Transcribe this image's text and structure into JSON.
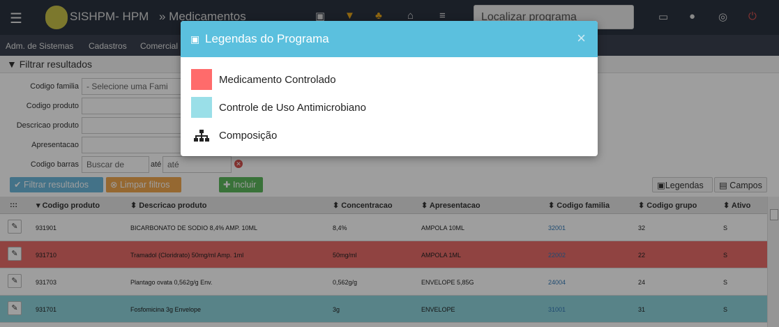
{
  "topbar": {
    "menu_icon": "hamburger-menu-icon",
    "app_name": "SISHPM- HPM",
    "breadcrumb": "» Medicamentos",
    "search_placeholder": "Localizar programa",
    "icons": [
      "legend-book-icon",
      "filter-icon",
      "sitemap-icon",
      "home-icon",
      "list-icon",
      "inbox-icon",
      "user-icon",
      "support-icon",
      "power-icon"
    ]
  },
  "menu": [
    "Adm. de Sistemas",
    "Cadastros",
    "Comercial"
  ],
  "filters": {
    "header": "Filtrar resultados",
    "fields": [
      {
        "label": "Codigo familia",
        "value": "- Selecione uma Fami"
      },
      {
        "label": "Codigo produto",
        "value": ""
      },
      {
        "label": "Descricao produto",
        "value": ""
      },
      {
        "label": "Apresentacao",
        "value": ""
      }
    ],
    "barcode": {
      "label": "Codigo barras",
      "from_placeholder": "Buscar de",
      "to_label": "até",
      "to_placeholder": "até"
    },
    "buttons": {
      "filter": "Filtrar resultados",
      "clear": "Limpar filtros",
      "add": "Incluir",
      "legend": "Legendas",
      "fields": "Campos"
    }
  },
  "table": {
    "columns": [
      "Codigo produto",
      "Descricao produto",
      "Concentracao",
      "Apresentacao",
      "Codigo familia",
      "Codigo grupo",
      "Ativo"
    ],
    "rows": [
      {
        "codigo": "931901",
        "descricao": "BICARBONATO DE SODIO 8,4% AMP. 10ML",
        "concentracao": "8,4%",
        "apresentacao": "AMPOLA 10ML",
        "familia": "32001",
        "grupo": "32",
        "ativo": "S",
        "highlight": "none"
      },
      {
        "codigo": "931710",
        "descricao": "Tramadol (Cloridrato) 50mg/ml Amp. 1ml",
        "concentracao": "50mg/ml",
        "apresentacao": "AMPOLA 1ML",
        "familia": "22002",
        "grupo": "22",
        "ativo": "S",
        "highlight": "controlado"
      },
      {
        "codigo": "931703",
        "descricao": "Plantago ovata 0,562g/g Env.",
        "concentracao": "0,562g/g",
        "apresentacao": "ENVELOPE 5,85G",
        "familia": "24004",
        "grupo": "24",
        "ativo": "S",
        "highlight": "none"
      },
      {
        "codigo": "931701",
        "descricao": "Fosfomicina 3g Envelope",
        "concentracao": "3g",
        "apresentacao": "ENVELOPE",
        "familia": "31001",
        "grupo": "31",
        "ativo": "S",
        "highlight": "antimicrobiano"
      }
    ]
  },
  "modal": {
    "title": "Legendas do Programa",
    "close": "×",
    "items": [
      {
        "label": "Medicamento Controlado",
        "color": "#ff6b6b"
      },
      {
        "label": "Controle de Uso Antimicrobiano",
        "color": "#9adfe8"
      },
      {
        "label": "Composição",
        "icon": "sitemap-icon"
      }
    ]
  },
  "colors": {
    "controlado_row": "#e86c6a",
    "antimicrobiano_row": "#8fd3dc",
    "accent": "#5bc0de"
  }
}
